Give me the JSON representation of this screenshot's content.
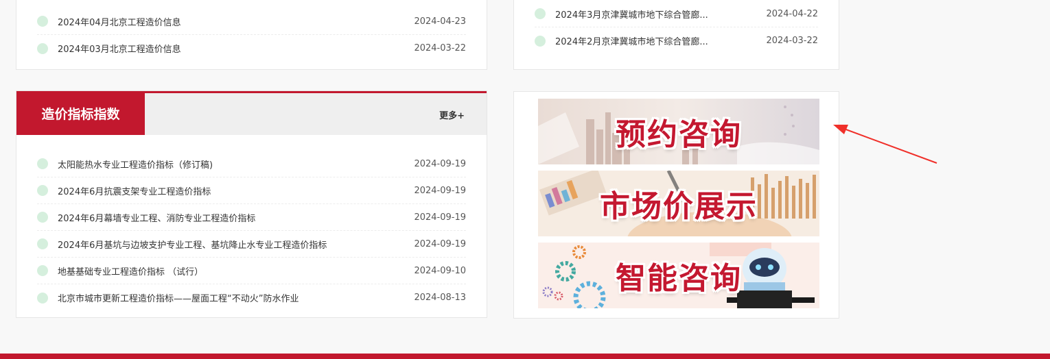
{
  "top_left_list": [
    {
      "title": "2024年04月北京工程造价信息",
      "date": "2024-04-23"
    },
    {
      "title": "2024年03月北京工程造价信息",
      "date": "2024-03-22"
    }
  ],
  "top_right_list": [
    {
      "title": "2024年3月京津冀城市地下综合管廊...",
      "date": "2024-04-22"
    },
    {
      "title": "2024年2月京津冀城市地下综合管廊...",
      "date": "2024-03-22"
    }
  ],
  "index_panel": {
    "title": "造价指标指数",
    "more": "更多+",
    "items": [
      {
        "title": "太阳能热水专业工程造价指标（修订稿)",
        "date": "2024-09-19"
      },
      {
        "title": "2024年6月抗震支架专业工程造价指标",
        "date": "2024-09-19"
      },
      {
        "title": "2024年6月幕墙专业工程、消防专业工程造价指标",
        "date": "2024-09-19"
      },
      {
        "title": "2024年6月基坑与边坡支护专业工程、基坑降止水专业工程造价指标",
        "date": "2024-09-19"
      },
      {
        "title": "地基基础专业工程造价指标 （试行）",
        "date": "2024-09-10"
      },
      {
        "title": "北京市城市更新工程造价指标——屋面工程“不动火”防水作业",
        "date": "2024-08-13"
      }
    ]
  },
  "banners": [
    {
      "label": "预约咨询"
    },
    {
      "label": "市场价展示"
    },
    {
      "label": "智能咨询"
    }
  ],
  "colors": {
    "accent": "#c2182e",
    "dot": "#d5efdd",
    "arrow": "#f0302a"
  }
}
